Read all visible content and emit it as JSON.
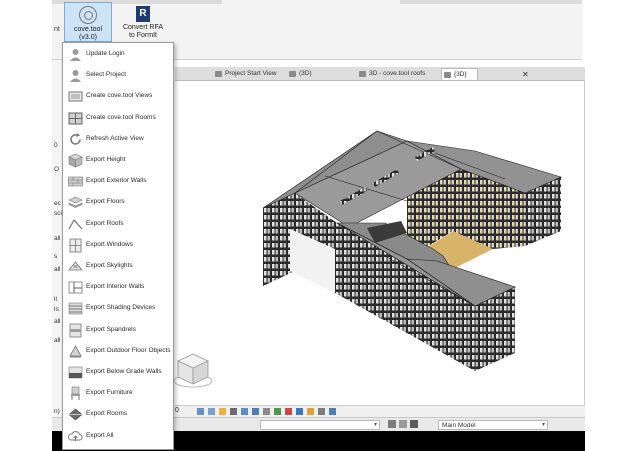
{
  "ribbon": {
    "cove_button": {
      "label": "cove.tool (v3.0)",
      "caret": "▾"
    },
    "rfa_button": {
      "label_line1": "Convert RFA",
      "label_line2": "to FormIt"
    },
    "left_edge_text": "nt"
  },
  "left_fragments": [
    "0",
    "O",
    "ec",
    "sci",
    "all",
    "s",
    "all",
    "ll",
    "ls",
    "all",
    "all",
    "n)",
    "0)",
    "ti"
  ],
  "tabs": [
    {
      "label": "Project Start View",
      "close": ""
    },
    {
      "label": "(3D)",
      "close": ""
    },
    {
      "label": "3D - cove.tool roofs",
      "close": ""
    },
    {
      "label": "{3D}",
      "close": "✕"
    }
  ],
  "menu": {
    "items": [
      {
        "label": "Update Login",
        "icon": "user-icon"
      },
      {
        "label": "Select Project",
        "icon": "user-icon"
      },
      {
        "label": "Create cove.tool Views",
        "icon": "views-icon"
      },
      {
        "label": "Create cove.tool Rooms",
        "icon": "rooms-icon"
      },
      {
        "label": "Refresh Active View",
        "icon": "refresh-icon"
      },
      {
        "label": "Export Height",
        "icon": "cube-icon"
      },
      {
        "label": "Export Exterior Walls",
        "icon": "brick-wall-icon"
      },
      {
        "label": "Export Floors",
        "icon": "layers-icon"
      },
      {
        "label": "Export Roofs",
        "icon": "roof-icon"
      },
      {
        "label": "Export Windows",
        "icon": "window-icon"
      },
      {
        "label": "Export Skylights",
        "icon": "skylight-icon"
      },
      {
        "label": "Export Interior Walls",
        "icon": "interior-wall-icon"
      },
      {
        "label": "Export Shading Devices",
        "icon": "shading-icon"
      },
      {
        "label": "Export Spandrels",
        "icon": "spandrel-icon"
      },
      {
        "label": "Export Outdoor Floor Objects",
        "icon": "outdoor-floor-icon"
      },
      {
        "label": "Export Below Grade Walls",
        "icon": "below-grade-icon"
      },
      {
        "label": "Export Furniture",
        "icon": "chair-icon"
      },
      {
        "label": "Export Rooms",
        "icon": "rooms-export-icon"
      },
      {
        "label": "Export All",
        "icon": "cloud-upload-icon"
      }
    ]
  },
  "status_bar": {
    "scale_text": "0"
  },
  "bottom_bar": {
    "workset": "",
    "model": "Main Model"
  }
}
